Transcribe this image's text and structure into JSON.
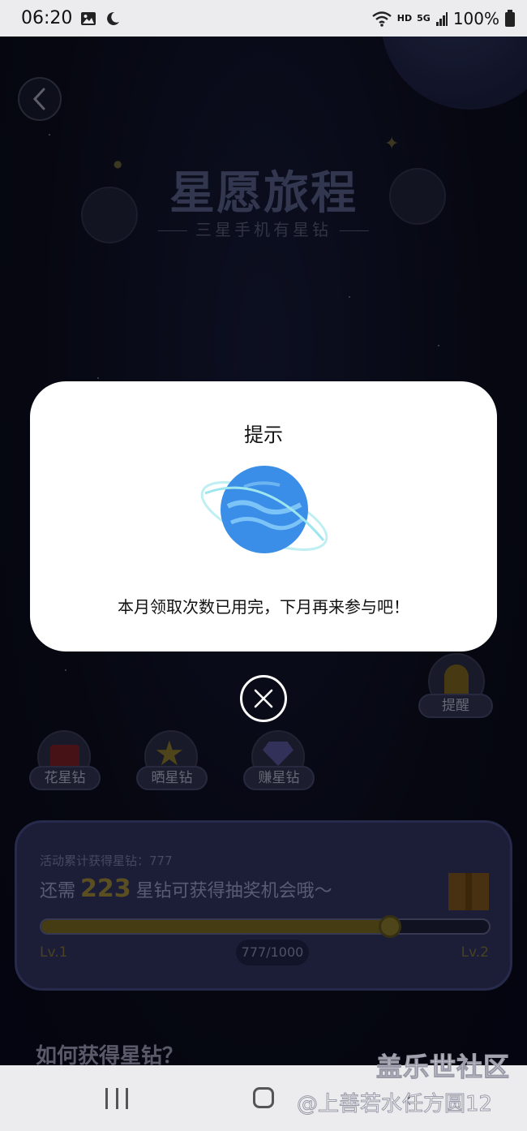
{
  "status_bar": {
    "time": "06:20",
    "network_small": "HD",
    "network_gen": "5G",
    "battery": "100%",
    "icons": [
      "image-icon",
      "moon-icon",
      "wifi-icon",
      "signal-icon",
      "battery-icon"
    ]
  },
  "header": {
    "title": "星愿旅程",
    "subtitle": "三星手机有星钻"
  },
  "actions": [
    {
      "label": "花星钻",
      "icon": "shopping-bag-icon"
    },
    {
      "label": "晒星钻",
      "icon": "star-icon"
    },
    {
      "label": "赚星钻",
      "icon": "diamond-icon"
    }
  ],
  "remind": {
    "label": "提醒",
    "icon": "bell-icon"
  },
  "progress": {
    "cumulative_text": "活动累计获得星钻：777",
    "need_prefix": "还需",
    "need_number": "223",
    "need_suffix": "星钻可获得抽奖机会哦～",
    "level_start": "Lv.1",
    "level_end": "Lv.2",
    "count": "777/1000",
    "fraction": 0.777
  },
  "section_title": "如何获得星钻？",
  "dialog": {
    "title": "提示",
    "message": "本月领取次数已用完，下月再来参与吧！"
  },
  "watermark": {
    "line1": "盖乐世社区",
    "line2": "@上善若水任方圆12"
  },
  "colors": {
    "background": "#0b0d1e",
    "dialog_bg": "#ffffff",
    "planet_blue": "#3a8ee8",
    "ring": "#9ee6ee"
  }
}
